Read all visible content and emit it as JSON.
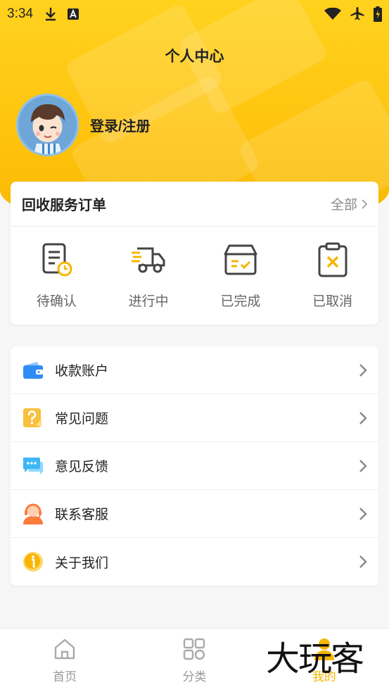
{
  "status_bar": {
    "time": "3:34"
  },
  "page": {
    "title": "个人中心"
  },
  "profile": {
    "login_label": "登录/注册"
  },
  "orders": {
    "title": "回收服务订单",
    "view_all": "全部",
    "items": [
      {
        "label": "待确认",
        "icon": "pending-document-icon"
      },
      {
        "label": "进行中",
        "icon": "delivery-truck-icon"
      },
      {
        "label": "已完成",
        "icon": "completed-box-icon"
      },
      {
        "label": "已取消",
        "icon": "cancelled-clipboard-icon"
      }
    ]
  },
  "menu": {
    "items": [
      {
        "label": "收款账户",
        "icon": "wallet-icon"
      },
      {
        "label": "常见问题",
        "icon": "question-icon"
      },
      {
        "label": "意见反馈",
        "icon": "feedback-chat-icon"
      },
      {
        "label": "联系客服",
        "icon": "customer-service-icon"
      },
      {
        "label": "关于我们",
        "icon": "info-icon"
      }
    ]
  },
  "tabbar": {
    "items": [
      {
        "label": "首页",
        "icon": "home-icon"
      },
      {
        "label": "分类",
        "icon": "category-icon"
      },
      {
        "label": "我的",
        "icon": "profile-icon"
      }
    ]
  },
  "watermark": "大玩客",
  "colors": {
    "accent": "#f7b500",
    "header": "#ffc40f"
  }
}
